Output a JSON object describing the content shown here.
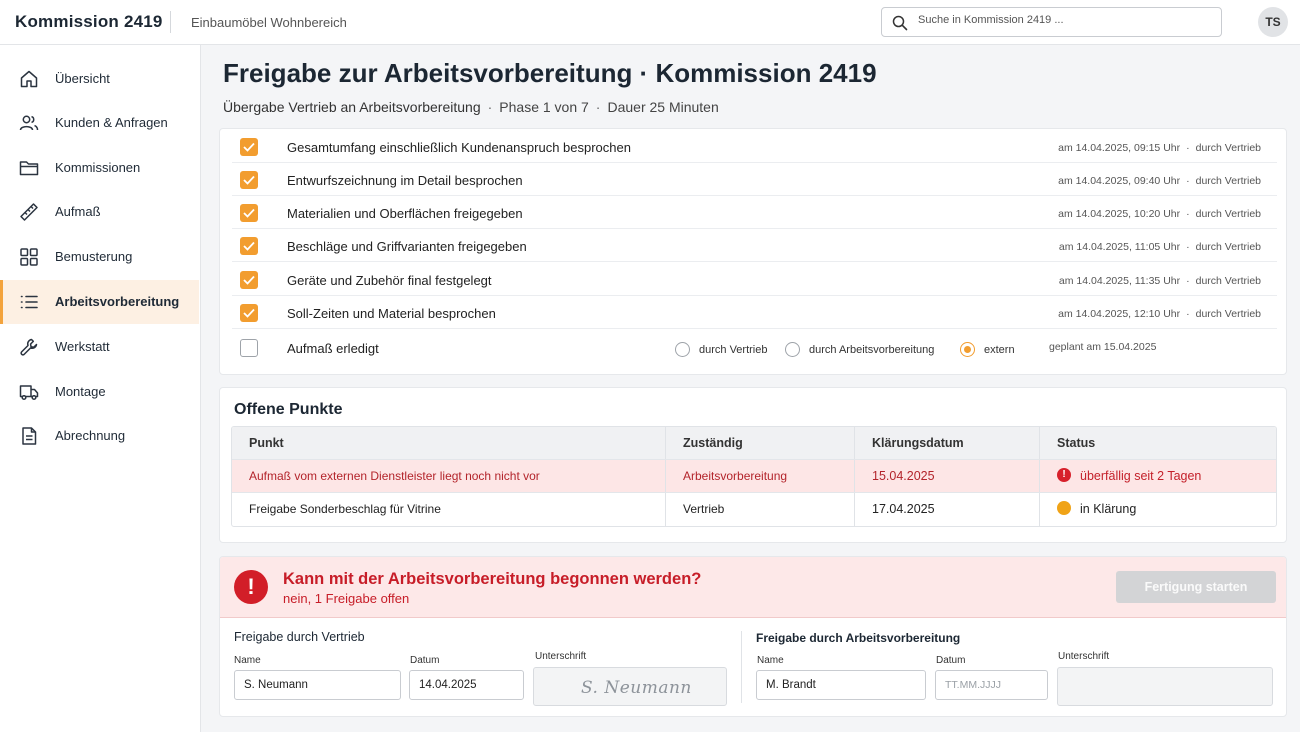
{
  "header": {
    "app_title": "Kommission 2419",
    "subtitle": "Einbaumöbel Wohnbereich",
    "search_placeholder": "Suche in Kommission 2419 ...",
    "user_initials": "TS"
  },
  "sidebar": {
    "items": [
      {
        "label": "Übersicht",
        "icon": "home-icon"
      },
      {
        "label": "Kunden & Anfragen",
        "icon": "users-icon"
      },
      {
        "label": "Kommissionen",
        "icon": "folder-icon"
      },
      {
        "label": "Aufmaß",
        "icon": "ruler-icon"
      },
      {
        "label": "Bemusterung",
        "icon": "grid-icon"
      },
      {
        "label": "Arbeitsvorbereitung",
        "icon": "list-icon",
        "active": true
      },
      {
        "label": "Werkstatt",
        "icon": "wrench-icon"
      },
      {
        "label": "Montage",
        "icon": "truck-icon"
      },
      {
        "label": "Abrechnung",
        "icon": "document-icon"
      }
    ]
  },
  "page": {
    "title": "Freigabe zur Arbeitsvor­bereitung · Kommission 2419",
    "sub_main": "Übergabe Vertrieb an Arbeitsvorbereitung",
    "sub_phase": "Phase 1 von 7",
    "sub_duration": "Dauer 25 Minuten",
    "separator": "·"
  },
  "checklist": {
    "items": [
      {
        "label": "Gesamtumfang einschließlich Kundenanspruch besprochen",
        "date": "am 14.04.2025, 09:15 Uhr",
        "by": "durch Vertrieb",
        "checked": true
      },
      {
        "label": "Entwurfszeichnung im Detail besprochen",
        "date": "am 14.04.2025, 09:40 Uhr",
        "by": "durch Vertrieb",
        "checked": true
      },
      {
        "label": "Materialien und Oberflächen freigegeben",
        "date": "am 14.04.2025, 10:20 Uhr",
        "by": "durch Vertrieb",
        "checked": true
      },
      {
        "label": "Beschläge und Griffvarianten freigegeben",
        "date": "am 14.04.2025, 11:05 Uhr",
        "by": "durch Vertrieb",
        "checked": true
      },
      {
        "label": "Geräte und Zubehör final festgelegt",
        "date": "am 14.04.2025, 11:35 Uhr",
        "by": "durch Vertrieb",
        "checked": true
      },
      {
        "label": "Soll-Zeiten und Material besprochen",
        "date": "am 14.04.2025, 12:10 Uhr",
        "by": "durch Vertrieb",
        "checked": true
      }
    ],
    "pending": {
      "label": "Aufmaß erledigt",
      "checked": false,
      "options": [
        "durch Vertrieb",
        "durch Arbeitsvorbereitung",
        "extern"
      ],
      "selected": "extern",
      "planned": "geplant am 15.04.2025"
    },
    "separator": "·"
  },
  "open_points": {
    "title": "Offene Punkte",
    "columns": [
      "Punkt",
      "Zuständig",
      "Klärungsdatum",
      "Status"
    ],
    "rows": [
      {
        "punkt": "Aufmaß vom externen Dienstleister liegt noch nicht vor",
        "zustaendig": "Arbeitsvorbereitung",
        "datum": "15.04.2025",
        "status": "überfällig seit 2 Tagen",
        "status_kind": "overdue"
      },
      {
        "punkt": "Freigabe Sonderbeschlag für Vitrine",
        "zustaendig": "Vertrieb",
        "datum": "17.04.2025",
        "status": "in Klärung",
        "status_kind": "pending"
      }
    ]
  },
  "release": {
    "question": "Kann mit der Arbeitsvorbereitung begonnen werden?",
    "answer": "nein, 1 Freigabe offen",
    "start_button": "Fertigung starten",
    "sales": {
      "title": "Freigabe durch Vertrieb",
      "name_label": "Name",
      "name_value": "S. Neumann",
      "date_label": "Datum",
      "date_value": "14.04.2025",
      "signature_label": "Unterschrift",
      "signature_value": "S. Neumann"
    },
    "prep": {
      "title": "Freigabe durch Arbeitsvorbereitung",
      "name_label": "Name",
      "name_value": "M. Brandt",
      "date_label": "Datum",
      "date_placeholder": "TT.MM.JJJJ",
      "signature_label": "Unterschrift"
    }
  },
  "colors": {
    "accent": "#f29d2f",
    "danger": "#d21e28",
    "danger_bg": "#fde8e8",
    "pending": "#f0a317"
  }
}
